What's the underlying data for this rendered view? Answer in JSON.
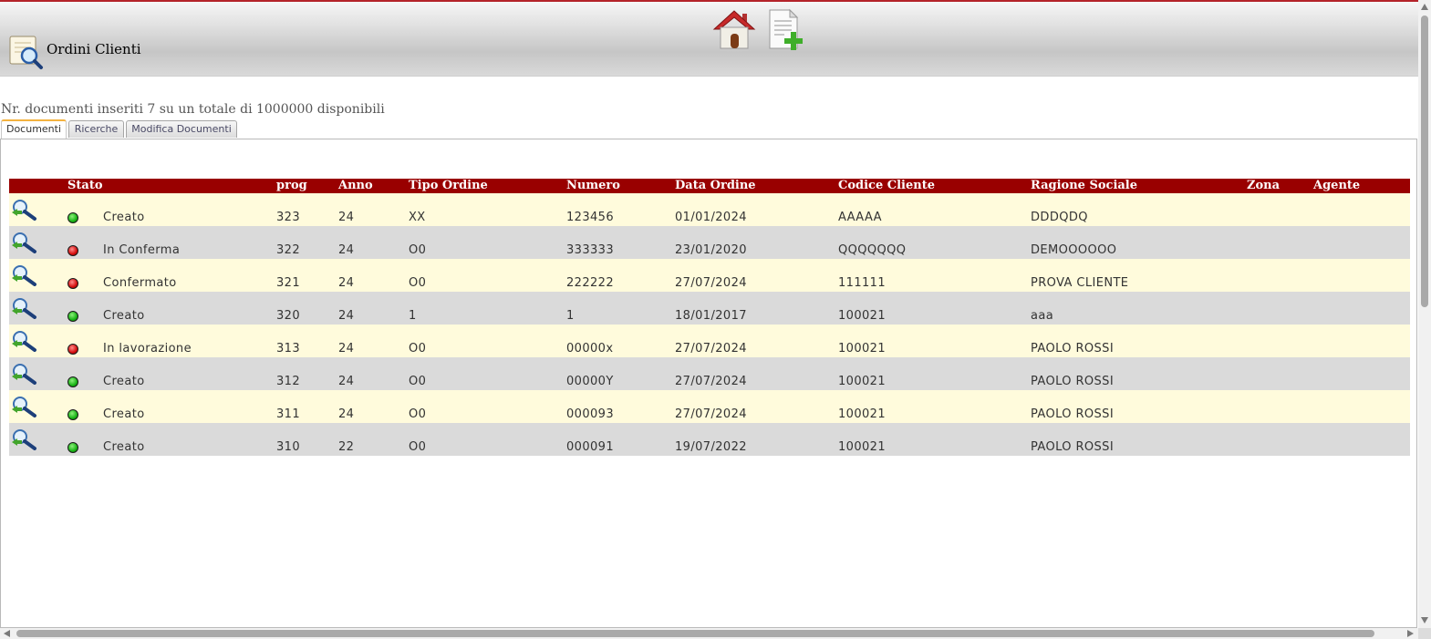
{
  "header": {
    "title": "Ordini Clienti",
    "app_icon": "document-search-icon",
    "home_icon": "home-icon",
    "new_doc_icon": "new-document-icon"
  },
  "summary": "Nr. documenti inseriti 7 su un totale di 1000000 disponibili",
  "tabs": [
    {
      "label": "Documenti",
      "active": true
    },
    {
      "label": "Ricerche",
      "active": false
    },
    {
      "label": "Modifica Documenti",
      "active": false
    }
  ],
  "table": {
    "columns": {
      "stato": "Stato",
      "prog": "prog",
      "anno": "Anno",
      "tipo": "Tipo Ordine",
      "numero": "Numero",
      "data": "Data Ordine",
      "codice": "Codice Cliente",
      "ragione": "Ragione Sociale",
      "zona": "Zona",
      "agente": "Agente"
    },
    "rows": [
      {
        "status_color": "green",
        "stato": "Creato",
        "prog": "323",
        "anno": "24",
        "tipo": "XX",
        "numero": "123456",
        "data": "01/01/2024",
        "codice": "AAAAA",
        "ragione": "DDDQDQ",
        "zona": "",
        "agente": ""
      },
      {
        "status_color": "red",
        "stato": "In Conferma",
        "prog": "322",
        "anno": "24",
        "tipo": "O0",
        "numero": "333333",
        "data": "23/01/2020",
        "codice": "QQQQQQQ",
        "ragione": "DEMOOOOOO",
        "zona": "",
        "agente": ""
      },
      {
        "status_color": "red",
        "stato": "Confermato",
        "prog": "321",
        "anno": "24",
        "tipo": "O0",
        "numero": "222222",
        "data": "27/07/2024",
        "codice": "111111",
        "ragione": "PROVA CLIENTE",
        "zona": "",
        "agente": ""
      },
      {
        "status_color": "green",
        "stato": "Creato",
        "prog": "320",
        "anno": "24",
        "tipo": "1",
        "numero": "1",
        "data": "18/01/2017",
        "codice": "100021",
        "ragione": "aaa",
        "zona": "",
        "agente": ""
      },
      {
        "status_color": "red",
        "stato": "In lavorazione",
        "prog": "313",
        "anno": "24",
        "tipo": "O0",
        "numero": "00000x",
        "data": "27/07/2024",
        "codice": "100021",
        "ragione": "PAOLO ROSSI",
        "zona": "",
        "agente": ""
      },
      {
        "status_color": "green",
        "stato": "Creato",
        "prog": "312",
        "anno": "24",
        "tipo": "O0",
        "numero": "00000Y",
        "data": "27/07/2024",
        "codice": "100021",
        "ragione": "PAOLO ROSSI",
        "zona": "",
        "agente": ""
      },
      {
        "status_color": "green",
        "stato": "Creato",
        "prog": "311",
        "anno": "24",
        "tipo": "O0",
        "numero": "000093",
        "data": "27/07/2024",
        "codice": "100021",
        "ragione": "PAOLO ROSSI",
        "zona": "",
        "agente": ""
      },
      {
        "status_color": "green",
        "stato": "Creato",
        "prog": "310",
        "anno": "22",
        "tipo": "O0",
        "numero": "000091",
        "data": "19/07/2022",
        "codice": "100021",
        "ragione": "PAOLO ROSSI",
        "zona": "",
        "agente": ""
      }
    ]
  }
}
